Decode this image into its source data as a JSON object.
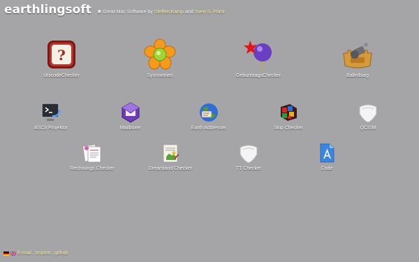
{
  "header": {
    "brand": "earthlingsoft",
    "tagline_prefix": "✖ Great Mac Software by",
    "author1": "Steffen Kamp",
    "and": "and",
    "author2": "Sven-S. Porst"
  },
  "apps_row1": [
    {
      "label": "UnicodeChecker",
      "icon": "unicode-checker-icon"
    },
    {
      "label": "Symmetries",
      "icon": "symmetries-icon"
    },
    {
      "label": "GeburtstagsChecker",
      "icon": "geburtstags-checker-icon"
    },
    {
      "label": "Ballerburg",
      "icon": "ballerburg-icon"
    }
  ],
  "apps_row2": [
    {
      "label": "ASCII Projektor",
      "icon": "ascii-projektor-icon"
    },
    {
      "label": "Mailboxer",
      "icon": "mailboxer-icon"
    },
    {
      "label": "Earth Addresser",
      "icon": "earth-addresser-icon"
    },
    {
      "label": "Skip Checker",
      "icon": "skip-checker-icon"
    },
    {
      "label": "QCiSM",
      "icon": "qcism-icon"
    }
  ],
  "apps_row3": [
    {
      "label": "Rechnungs Checker",
      "icon": "rechnungs-checker-icon"
    },
    {
      "label": "Dreamland Checker",
      "icon": "dreamland-checker-icon"
    },
    {
      "label": "TT Checker",
      "icon": "tt-checker-icon"
    },
    {
      "label": "Code",
      "icon": "code-icon"
    }
  ],
  "footer": {
    "email": "E-mail",
    "sep1": ".",
    "imprint": "Imprint",
    "sep2": ".",
    "github": "github"
  }
}
